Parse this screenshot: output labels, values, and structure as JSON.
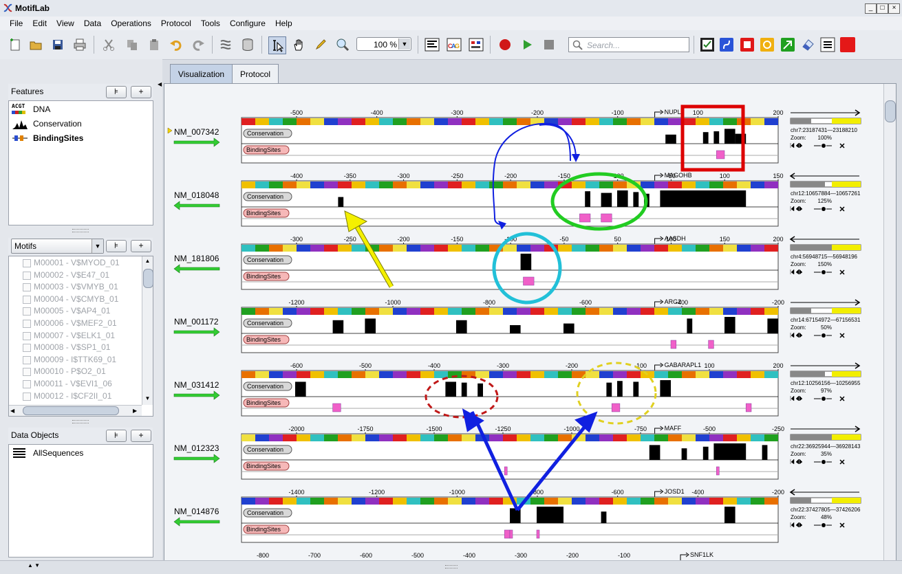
{
  "window": {
    "title": "MotifLab",
    "controls": [
      "_",
      "□",
      "×"
    ]
  },
  "menu": [
    "File",
    "Edit",
    "View",
    "Data",
    "Operations",
    "Protocol",
    "Tools",
    "Configure",
    "Help"
  ],
  "toolbar": {
    "zoom_value": "100 %",
    "search_placeholder": "Search..."
  },
  "features": {
    "title": "Features",
    "items": [
      "DNA",
      "Conservation",
      "BindingSites"
    ],
    "dna_icon_text": "ACGT"
  },
  "motifs": {
    "title": "Motifs",
    "items": [
      "M00001 - V$MYOD_01",
      "M00002 - V$E47_01",
      "M00003 - V$VMYB_01",
      "M00004 - V$CMYB_01",
      "M00005 - V$AP4_01",
      "M00006 - V$MEF2_01",
      "M00007 - V$ELK1_01",
      "M00008 - V$SP1_01",
      "M00009 - I$TTK69_01",
      "M00010 - P$O2_01",
      "M00011 - V$EVI1_06",
      "M00012 - I$CF2II_01"
    ]
  },
  "data_objects": {
    "title": "Data Objects",
    "items": [
      "AllSequences"
    ]
  },
  "tabs": [
    "Visualization",
    "Protocol"
  ],
  "track_labels": {
    "conservation": "Conservation",
    "bindingsites": "BindingSites"
  },
  "info_labels": {
    "zoom": "Zoom:"
  },
  "colors": {
    "conservation_badge": "#d8d8d8",
    "bindingsites_badge": "#f6b8b8",
    "strand_arrow": "#33cc33",
    "selected_marker": "#f2d600",
    "red_square": "#dd0000",
    "green_circle": "#22cc22",
    "cyan_circle": "#22c0d8",
    "blue_arrow": "#1020e0",
    "yellow_arrow": "#f4f000"
  },
  "sequences": [
    {
      "name": "NM_007342",
      "strand": "+",
      "gene": "NUPL2",
      "ticks": [
        "-500",
        "-400",
        "-300",
        "-200",
        "-100",
        "100",
        "200"
      ],
      "region": "chr7:23187431—23188210",
      "zoom": "100%",
      "cons": [
        [
          0.79,
          0.81,
          0.55
        ],
        [
          0.86,
          0.87,
          0.7
        ],
        [
          0.88,
          0.89,
          0.75
        ],
        [
          0.9,
          0.92,
          0.9
        ],
        [
          0.92,
          0.94,
          0.6
        ]
      ],
      "sites": [
        [
          0.885,
          0.9
        ]
      ]
    },
    {
      "name": "NM_018048",
      "strand": "-",
      "gene": "MAGOHB",
      "ticks": [
        "-400",
        "-350",
        "-300",
        "-250",
        "-200",
        "-150",
        "-100",
        "-50",
        "100",
        "150"
      ],
      "region": "chr12:10657884—10657261",
      "zoom": "125%",
      "cons": [
        [
          0.18,
          0.19,
          0.6
        ],
        [
          0.64,
          0.65,
          0.95
        ],
        [
          0.67,
          0.69,
          0.85
        ],
        [
          0.7,
          0.72,
          1
        ],
        [
          0.73,
          0.74,
          0.9
        ],
        [
          0.75,
          0.76,
          0.8
        ],
        [
          0.78,
          0.94,
          1
        ]
      ],
      "sites": [
        [
          0.63,
          0.65
        ],
        [
          0.67,
          0.69
        ]
      ]
    },
    {
      "name": "NM_181806",
      "strand": "-",
      "gene": "AASDH",
      "ticks": [
        "-300",
        "-250",
        "-200",
        "-150",
        "-100",
        "-50",
        "50",
        "100",
        "150",
        "200"
      ],
      "region": "chr4:56948715—56948196",
      "zoom": "150%",
      "cons": [
        [
          0.52,
          0.54,
          1
        ]
      ],
      "sites": [
        [
          0.525,
          0.545
        ]
      ]
    },
    {
      "name": "NM_001172",
      "strand": "+",
      "gene": "ARG2",
      "ticks": [
        "-1200",
        "-1000",
        "-800",
        "-600",
        "-400",
        "-200"
      ],
      "region": "chr14:67154972—67156531",
      "zoom": "50%",
      "cons": [
        [
          0.17,
          0.19,
          0.8
        ],
        [
          0.23,
          0.25,
          0.9
        ],
        [
          0.4,
          0.42,
          0.8
        ],
        [
          0.5,
          0.52,
          0.5
        ],
        [
          0.6,
          0.62,
          0.6
        ],
        [
          0.83,
          0.84,
          0.9
        ],
        [
          0.9,
          0.92,
          1
        ],
        [
          0.98,
          1,
          0.9
        ]
      ],
      "sites": [
        [
          0.8,
          0.81
        ],
        [
          0.87,
          0.88
        ]
      ]
    },
    {
      "name": "NM_031412",
      "strand": "+",
      "gene": "GABARAPL1",
      "ticks": [
        "-600",
        "-500",
        "-400",
        "-300",
        "-200",
        "-100",
        "100",
        "200"
      ],
      "region": "chr12:10256156—10256955",
      "zoom": "97%",
      "cons": [
        [
          0.1,
          0.12,
          0.9
        ],
        [
          0.38,
          0.4,
          0.9
        ],
        [
          0.41,
          0.42,
          0.85
        ],
        [
          0.44,
          0.45,
          0.8
        ],
        [
          0.68,
          0.69,
          0.85
        ],
        [
          0.7,
          0.71,
          0.95
        ],
        [
          0.73,
          0.74,
          0.9
        ],
        [
          0.78,
          0.8,
          1
        ]
      ],
      "sites": [
        [
          0.17,
          0.185
        ],
        [
          0.69,
          0.705
        ],
        [
          0.94,
          0.95
        ]
      ]
    },
    {
      "name": "NM_012323",
      "strand": "+",
      "gene": "MAFF",
      "ticks": [
        "-2000",
        "-1750",
        "-1500",
        "-1250",
        "-1000",
        "-750",
        "-500",
        "-250"
      ],
      "region": "chr22:36925944—36928143",
      "zoom": "35%",
      "cons": [
        [
          0.76,
          0.78,
          0.9
        ],
        [
          0.82,
          0.83,
          0.7
        ],
        [
          0.86,
          0.87,
          0.8
        ],
        [
          0.88,
          0.94,
          1
        ],
        [
          0.97,
          0.98,
          0.9
        ]
      ],
      "sites": [
        [
          0.49,
          0.495
        ],
        [
          0.885,
          0.89
        ]
      ]
    },
    {
      "name": "NM_014876",
      "strand": "-",
      "gene": "JOSD1",
      "ticks": [
        "-1400",
        "-1200",
        "-1000",
        "-800",
        "-600",
        "-400",
        "-200"
      ],
      "region": "chr22:37427805—37426206",
      "zoom": "48%",
      "cons": [
        [
          0.5,
          0.52,
          0.9
        ],
        [
          0.55,
          0.6,
          1
        ],
        [
          0.67,
          0.68,
          0.7
        ],
        [
          0.9,
          0.92,
          1
        ]
      ],
      "sites": [
        [
          0.49,
          0.5
        ],
        [
          0.5,
          0.505
        ],
        [
          0.55,
          0.555
        ]
      ]
    }
  ],
  "partial_sequence": {
    "gene": "SNF1LK",
    "ticks": [
      "-800",
      "-700",
      "-600",
      "-500",
      "-400",
      "-300",
      "-200",
      "-100"
    ]
  }
}
